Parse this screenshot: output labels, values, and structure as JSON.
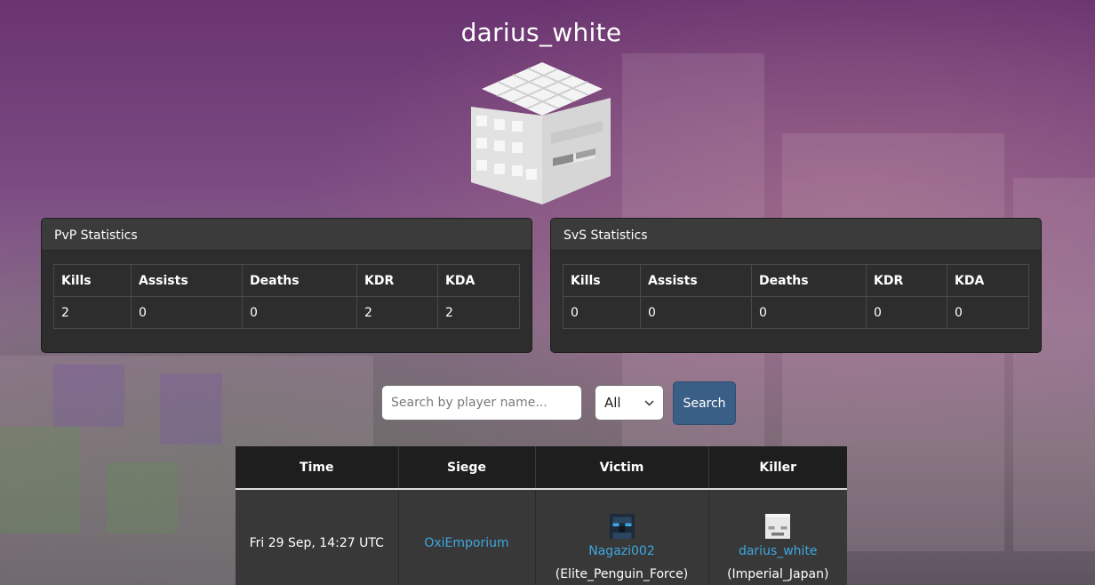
{
  "player": {
    "username": "darius_white"
  },
  "pvp_panel": {
    "title": "PvP Statistics",
    "headers": [
      "Kills",
      "Assists",
      "Deaths",
      "KDR",
      "KDA"
    ],
    "values": [
      "2",
      "0",
      "0",
      "2",
      "2"
    ]
  },
  "svs_panel": {
    "title": "SvS Statistics",
    "headers": [
      "Kills",
      "Assists",
      "Deaths",
      "KDR",
      "KDA"
    ],
    "values": [
      "0",
      "0",
      "0",
      "0",
      "0"
    ]
  },
  "search": {
    "placeholder": "Search by player name...",
    "filter_value": "All",
    "button_label": "Search"
  },
  "kills_table": {
    "headers": [
      "Time",
      "Siege",
      "Victim",
      "Killer"
    ],
    "rows": [
      {
        "time": "Fri 29 Sep, 14:27 UTC",
        "siege": "OxiEmporium",
        "victim_name": "Nagazi002",
        "victim_team": "(Elite_Penguin_Force)",
        "killer_name": "darius_white",
        "killer_team": "(Imperial_Japan)"
      }
    ]
  },
  "colors": {
    "link": "#3ea8e0",
    "panel_bg": "#2d2d2d",
    "button": "#3a5f86"
  }
}
